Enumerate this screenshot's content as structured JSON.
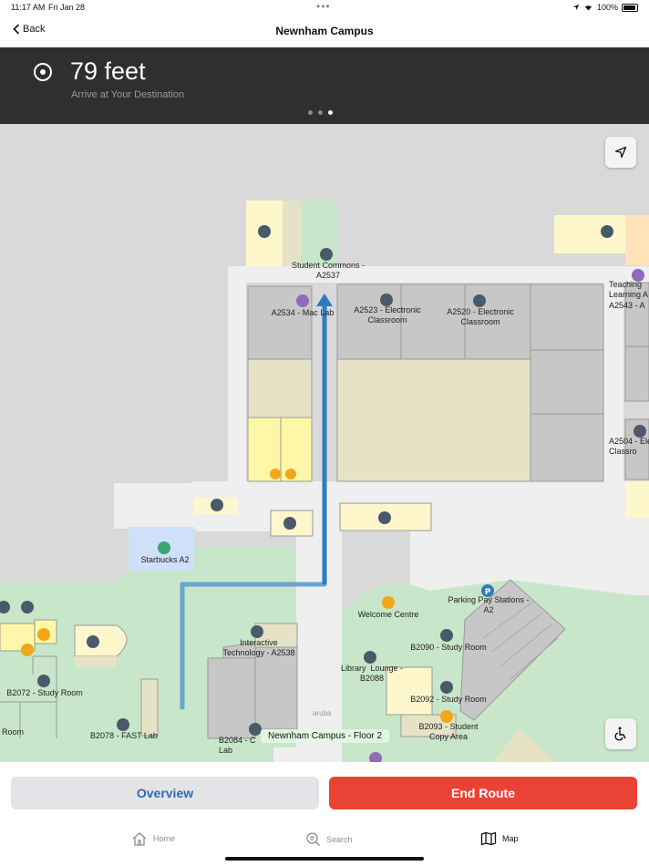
{
  "status": {
    "time": "11:17 AM",
    "date": "Fri Jan 28",
    "battery": "100%"
  },
  "nav": {
    "back_label": "Back",
    "title": "Newnham Campus"
  },
  "banner": {
    "distance": "79 feet",
    "instruction": "Arrive at Your Destination",
    "page_index": 3,
    "page_count": 3
  },
  "map": {
    "labels": {
      "student_commons": "Student Commons -\nA2537",
      "mac_lab": "A2534 - Mac Lab",
      "a2523": "A2523 - Electronic\nClassroom",
      "a2520": "A2520 - Electronic\nClassroom",
      "teaching": "Teaching\nLearning A\nA2543 - A",
      "a2504": "A2504 - Ele\nClassro",
      "starbucks": "Starbucks A2",
      "parking": "Parking Pay Stations -\nA2",
      "welcome": "Welcome Centre",
      "b2090": "B2090 - Study Room",
      "library": "Library  Lounge -\nB2088",
      "interactive": "Interactive\nTechnology - A2538",
      "b2092": "B2092 - Study Room",
      "b2093": "B2093 - Student\nCopy Area",
      "b2072": "B2072 - Study Room",
      "room": "Room",
      "b2078": "B2078 - FAST Lab",
      "b2084": "B2084 - C\nLab"
    },
    "floor": "Newnham Campus - Floor 2",
    "watermark": "aruba"
  },
  "actions": {
    "overview": "Overview",
    "end_route": "End Route"
  },
  "tabs": [
    {
      "label": "Home",
      "active": false
    },
    {
      "label": "Search",
      "active": false
    },
    {
      "label": "Map",
      "active": true
    }
  ],
  "colors": {
    "banner": "#2f2f2f",
    "route": "#2f7bc0",
    "end_route": "#ea4335",
    "overview_text": "#2e6ab3"
  }
}
